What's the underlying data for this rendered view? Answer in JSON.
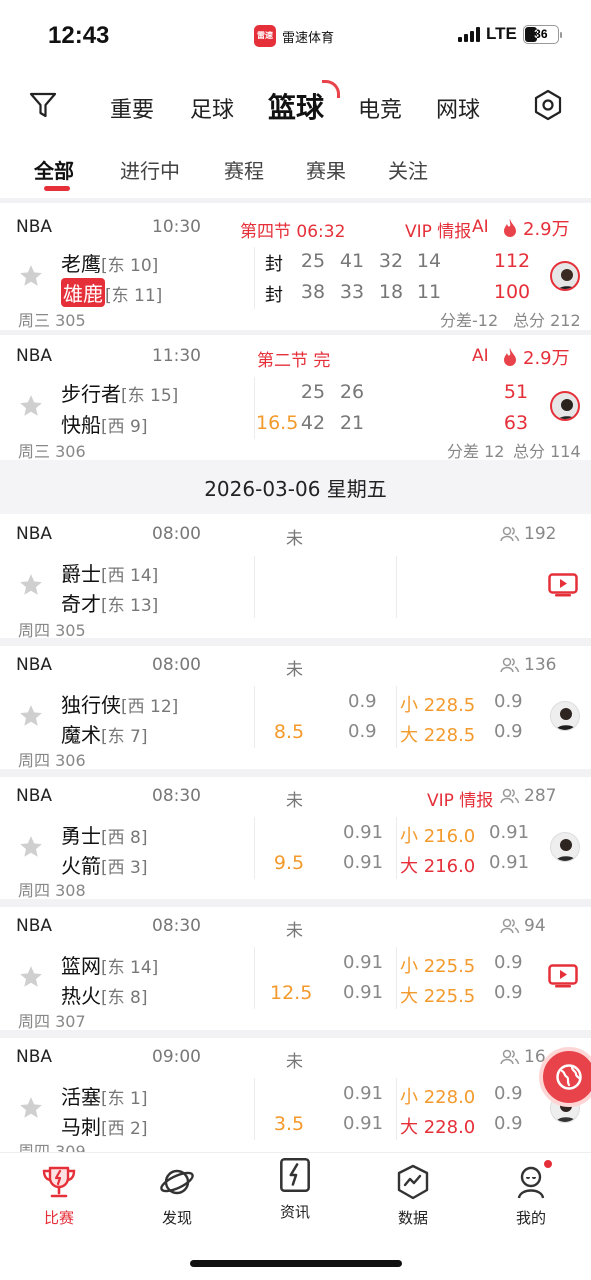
{
  "status_bar": {
    "time": "12:43",
    "app_logo_text": "雷速",
    "app_name": "雷速体育",
    "network": "LTE",
    "battery": "36"
  },
  "sports_nav": {
    "items": [
      "重要",
      "足球",
      "篮球",
      "电竞",
      "网球"
    ],
    "active": "篮球"
  },
  "sub_tabs": {
    "items": [
      "全部",
      "进行中",
      "赛程",
      "赛果",
      "关注"
    ],
    "active": "全部"
  },
  "matches": [
    {
      "league": "NBA",
      "time": "10:30",
      "status": "第四节 06:32",
      "vip": "VIP 情报",
      "ai": "AI",
      "heat": "2.9万",
      "home": {
        "name": "老鹰",
        "rank": "[东 10]",
        "mark": "封",
        "q": [
          "25",
          "41",
          "32",
          "14"
        ],
        "total": "112"
      },
      "away": {
        "name": "雄鹿",
        "rank": "[东 11]",
        "mark": "封",
        "q": [
          "38",
          "33",
          "18",
          "11"
        ],
        "total": "100"
      },
      "day": "周三 305",
      "diff": "分差-12",
      "sum": "总分 212"
    },
    {
      "league": "NBA",
      "time": "11:30",
      "status": "第二节 完",
      "ai": "AI",
      "heat": "2.9万",
      "home": {
        "name": "步行者",
        "rank": "[东 15]",
        "q": [
          "25",
          "26"
        ],
        "total": "51"
      },
      "away": {
        "name": "快船",
        "rank": "[西 9]",
        "handicap": "16.5",
        "q": [
          "42",
          "21"
        ],
        "total": "63"
      },
      "day": "周三 306",
      "diff": "分差 12",
      "sum": "总分 114"
    }
  ],
  "date_header": "2026-03-06 星期五",
  "schedule": [
    {
      "league": "NBA",
      "time": "08:00",
      "status": "未",
      "count": "192",
      "home": {
        "name": "爵士",
        "rank": "[西 14]"
      },
      "away": {
        "name": "奇才",
        "rank": "[东 13]"
      },
      "day": "周四 305"
    },
    {
      "league": "NBA",
      "time": "08:00",
      "status": "未",
      "count": "136",
      "home": {
        "name": "独行侠",
        "rank": "[西 12]",
        "o1": "0.9",
        "ou": "小 228.5",
        "o2": "0.9"
      },
      "away": {
        "name": "魔术",
        "rank": "[东 7]",
        "handicap": "8.5",
        "o1": "0.9",
        "ou": "大 228.5",
        "o2": "0.9"
      },
      "day": "周四 306"
    },
    {
      "league": "NBA",
      "time": "08:30",
      "status": "未",
      "vip": "VIP 情报",
      "count": "287",
      "home": {
        "name": "勇士",
        "rank": "[西 8]",
        "o1": "0.91",
        "ou": "小 216.0",
        "o2": "0.91"
      },
      "away": {
        "name": "火箭",
        "rank": "[西 3]",
        "handicap": "9.5",
        "o1": "0.91",
        "ou": "大 216.0",
        "o2": "0.91"
      },
      "day": "周四 308"
    },
    {
      "league": "NBA",
      "time": "08:30",
      "status": "未",
      "count": "94",
      "home": {
        "name": "篮网",
        "rank": "[东 14]",
        "o1": "0.91",
        "ou": "小 225.5",
        "o2": "0.9"
      },
      "away": {
        "name": "热火",
        "rank": "[东 8]",
        "handicap": "12.5",
        "o1": "0.91",
        "ou": "大 225.5",
        "o2": "0.9"
      },
      "day": "周四 307"
    },
    {
      "league": "NBA",
      "time": "09:00",
      "status": "未",
      "count": "16",
      "home": {
        "name": "活塞",
        "rank": "[东 1]",
        "o1": "0.91",
        "ou": "小 228.0",
        "o2": "0.9"
      },
      "away": {
        "name": "马刺",
        "rank": "[西 2]",
        "handicap": "3.5",
        "o1": "0.91",
        "ou": "大 228.0",
        "o2": "0.9"
      },
      "day": "周四 309"
    }
  ],
  "bottom_tabs": {
    "items": [
      "比赛",
      "发现",
      "资讯",
      "数据",
      "我的"
    ],
    "active": "比赛"
  },
  "colors": {
    "accent": "#e5303a",
    "handicap": "#f39a2c",
    "muted": "#777777"
  }
}
